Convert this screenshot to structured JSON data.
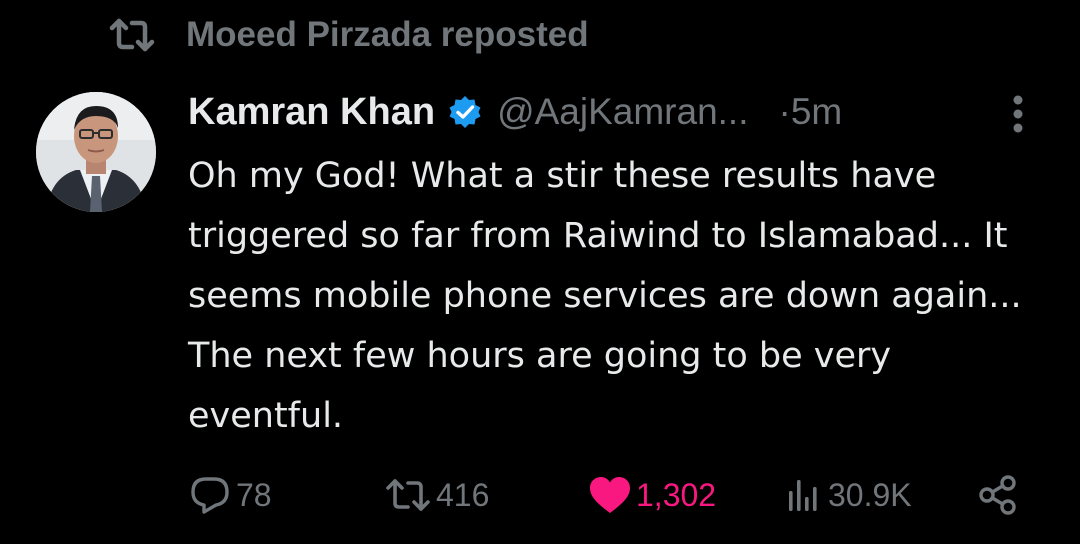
{
  "repost": {
    "label": "Moeed Pirzada reposted"
  },
  "tweet": {
    "display_name": "Kamran Khan",
    "handle": "@AajKamran...",
    "time": "·5m",
    "text": "Oh my God! What a stir these results have triggered so far from Raiwind to Islamabad... It seems mobile phone services are down again... The next few hours are going to be very eventful."
  },
  "actions": {
    "replies": "78",
    "reposts": "416",
    "likes": "1,302",
    "views": "30.9K"
  },
  "icons": {
    "repost": "repost-icon",
    "verified": "verified-badge-icon",
    "more": "more-vertical-icon",
    "reply": "reply-icon",
    "like": "heart-filled-icon",
    "views": "views-bar-chart-icon",
    "share": "share-icon"
  },
  "colors": {
    "background": "#000000",
    "text": "#e7e9ea",
    "muted": "#71767b",
    "like": "#f91880",
    "verified": "#1d9bf0"
  }
}
